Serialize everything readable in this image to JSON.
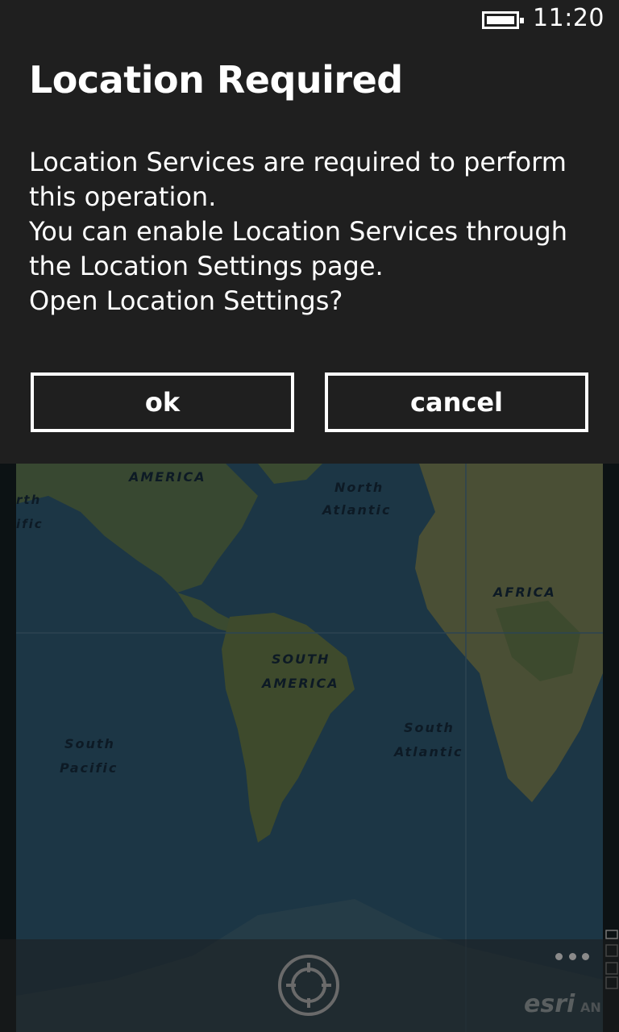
{
  "status_bar": {
    "time": "11:20",
    "battery_icon": "battery-icon"
  },
  "dialog": {
    "title": "Location Required",
    "message": "Location Services are required to perform\nthis operation.\nYou can enable Location Services through\nthe Location Settings page.\nOpen Location Settings?",
    "ok_label": "ok",
    "cancel_label": "cancel"
  },
  "map": {
    "labels": {
      "america": "AMERICA",
      "north_pacific_1": "rth",
      "north_pacific_2": "ific",
      "north": "North",
      "atlantic": "Atlantic",
      "africa": "AFRICA",
      "south": "SOUTH",
      "america2": "AMERICA",
      "south_pacific_1": "South",
      "south_pacific_2": "Pacific",
      "south_atlantic_1": "South",
      "south_atlantic_2": "Atlantic"
    },
    "attribution": "esri",
    "attribution_tail": "AN"
  },
  "app_bar": {
    "locate_icon": "locate-icon",
    "more_icon": "more-icon"
  },
  "colors": {
    "dialog_bg": "#1f1f1f",
    "ocean": "#1e3a48",
    "land": "#3b4a2c"
  }
}
